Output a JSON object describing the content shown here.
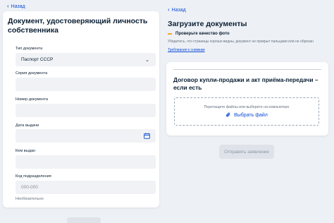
{
  "left": {
    "back_label": "Назад",
    "title": "Документ, удостоверяющий личность собственника",
    "fields": {
      "doc_type": {
        "label": "Тип документа",
        "value": "Паспорт СССР"
      },
      "series": {
        "label": "Серия документа",
        "value": ""
      },
      "number": {
        "label": "Номер документа",
        "value": ""
      },
      "issue_date": {
        "label": "Дата выдачи",
        "value": ""
      },
      "issued_by": {
        "label": "Кем выдан",
        "value": ""
      },
      "division_code": {
        "label": "Код подразделения",
        "placeholder": "000-000",
        "hint": "Необязательно"
      }
    }
  },
  "right": {
    "back_label": "Назад",
    "title": "Загрузите документы",
    "check_title": "Проверьте качество фото",
    "check_desc": "Убедитесь, что страницы хорошо видны, документ не прикрыт пальцами или не обрезан",
    "requirements_link": "Требования к снимкам",
    "doc_title": "Договор купли-продажи и акт приёма-передачи – если есть",
    "drop_hint": "Перетащите файлы или выберите на компьютере",
    "choose_file": "Выбрать файл",
    "submit_label": "Отправить заявление"
  },
  "colors": {
    "accent": "#0d4cd3",
    "background": "#edf0f5",
    "field_bg": "#f0f2f5",
    "bullet": "#f5a623"
  },
  "icons": {
    "back": "chevron-left-icon",
    "select": "chevron-down-icon",
    "date": "calendar-icon",
    "file": "paperclip-icon"
  }
}
